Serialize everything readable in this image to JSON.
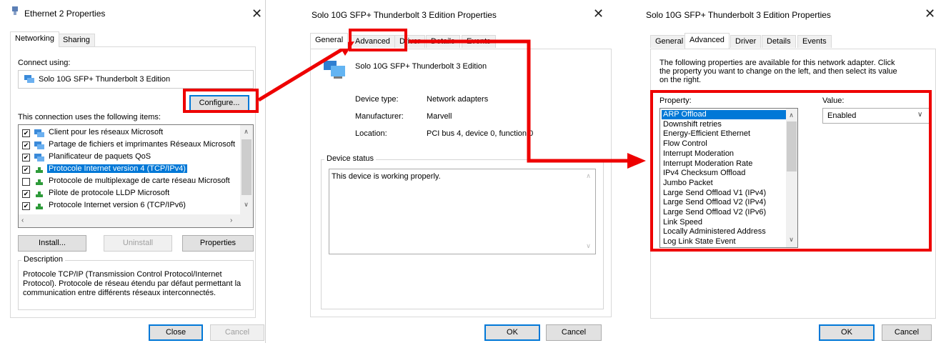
{
  "win1": {
    "title": "Ethernet 2 Properties",
    "close": "✕",
    "tabs": [
      "Networking",
      "Sharing"
    ],
    "connect_using_label": "Connect using:",
    "adapter_name": "Solo 10G SFP+ Thunderbolt 3 Edition",
    "configure_label": "Configure...",
    "items_label": "This connection uses the following items:",
    "items": [
      {
        "label": "Client pour les réseaux Microsoft",
        "checked": true
      },
      {
        "label": "Partage de fichiers et imprimantes Réseaux Microsoft",
        "checked": true
      },
      {
        "label": "Planificateur de paquets QoS",
        "checked": true
      },
      {
        "label": "Protocole Internet version 4 (TCP/IPv4)",
        "checked": true,
        "selected": true
      },
      {
        "label": "Protocole de multiplexage de carte réseau Microsoft",
        "checked": false
      },
      {
        "label": "Pilote de protocole LLDP Microsoft",
        "checked": true
      },
      {
        "label": "Protocole Internet version 6 (TCP/IPv6)",
        "checked": true
      }
    ],
    "install_label": "Install...",
    "uninstall_label": "Uninstall",
    "properties_label": "Properties",
    "description_label": "Description",
    "description_line1": "Protocole TCP/IP (Transmission Control Protocol/Internet",
    "description_line2": "Protocol). Protocole de réseau étendu par défaut permettant la",
    "description_line3": "communication entre différents réseaux interconnectés.",
    "close_label": "Close",
    "cancel_label": "Cancel"
  },
  "win2": {
    "title": "Solo 10G SFP+ Thunderbolt 3 Edition Properties",
    "close": "✕",
    "tabs": [
      "General",
      "Advanced",
      "Driver",
      "Details",
      "Events"
    ],
    "device_name": "Solo 10G SFP+ Thunderbolt 3 Edition",
    "device_type_label": "Device type:",
    "device_type_value": "Network adapters",
    "manufacturer_label": "Manufacturer:",
    "manufacturer_value": "Marvell",
    "location_label": "Location:",
    "location_value": "PCI bus 4, device 0, function 0",
    "status_label": "Device status",
    "status_text": "This device is working properly.",
    "ok_label": "OK",
    "cancel_label": "Cancel"
  },
  "win3": {
    "title": "Solo 10G SFP+ Thunderbolt 3 Edition Properties",
    "close": "✕",
    "tabs": [
      "General",
      "Advanced",
      "Driver",
      "Details",
      "Events"
    ],
    "intro_line1": "The following properties are available for this network adapter. Click",
    "intro_line2": "the property you want to change on the left, and then select its value",
    "intro_line3": "on the right.",
    "property_label": "Property:",
    "value_label": "Value:",
    "properties": [
      "ARP Offload",
      "Downshift retries",
      "Energy-Efficient Ethernet",
      "Flow Control",
      "Interrupt Moderation",
      "Interrupt Moderation Rate",
      "IPv4 Checksum Offload",
      "Jumbo Packet",
      "Large Send Offload V1 (IPv4)",
      "Large Send Offload V2 (IPv4)",
      "Large Send Offload V2 (IPv6)",
      "Link Speed",
      "Locally Administered Address",
      "Log Link State Event"
    ],
    "value_selected": "Enabled",
    "ok_label": "OK",
    "cancel_label": "Cancel"
  },
  "colors": {
    "highlight": "#ee0000",
    "selection": "#0078d7"
  }
}
